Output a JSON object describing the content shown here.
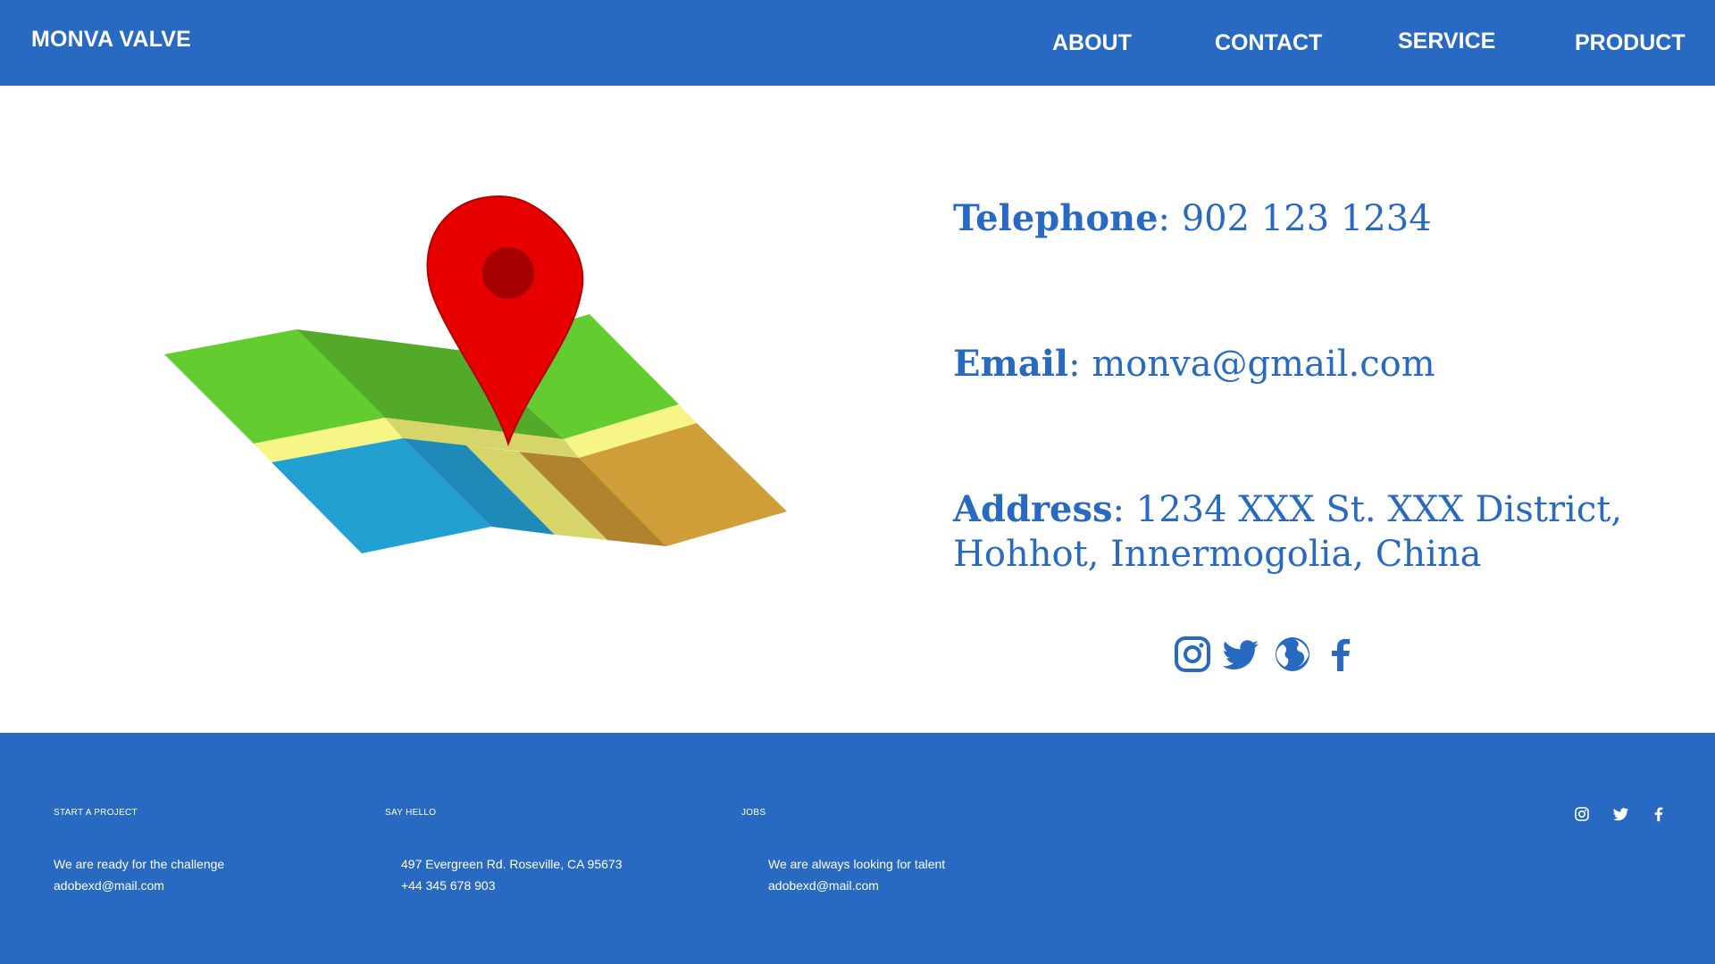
{
  "header": {
    "brand": "MONVA VALVE",
    "nav": {
      "about": "ABOUT",
      "contact": "CONTACT",
      "service": "SERVICE",
      "product": "PRODUCT"
    }
  },
  "contact": {
    "telephone": {
      "label": "Telephone",
      "value": "902 123 1234"
    },
    "email": {
      "label": "Email",
      "value": "monva@gmail.com"
    },
    "address": {
      "label": "Address",
      "line1": "1234 XXX St. XXX District,",
      "line2": "Hohhot, Innermogolia, China"
    },
    "social_icons": [
      "instagram-icon",
      "twitter-icon",
      "globe-icon",
      "facebook-icon"
    ]
  },
  "illustration": {
    "icon": "map-with-location-pin"
  },
  "footer": {
    "columns": [
      {
        "heading": "START A PROJECT",
        "lines": [
          "We are ready for the challenge",
          "adobexd@mail.com"
        ]
      },
      {
        "heading": "SAY HELLO",
        "lines": [
          "497 Evergreen Rd. Roseville, CA 95673",
          "+44 345 678 903"
        ]
      },
      {
        "heading": "JOBS",
        "lines": [
          "We are always looking for talent",
          "adobexd@mail.com"
        ]
      }
    ],
    "social_icons": [
      "instagram-icon",
      "twitter-icon",
      "facebook-icon"
    ]
  },
  "colors": {
    "brand_blue": "#2869c1",
    "white": "#ffffff",
    "pin_red": "#e60000"
  }
}
